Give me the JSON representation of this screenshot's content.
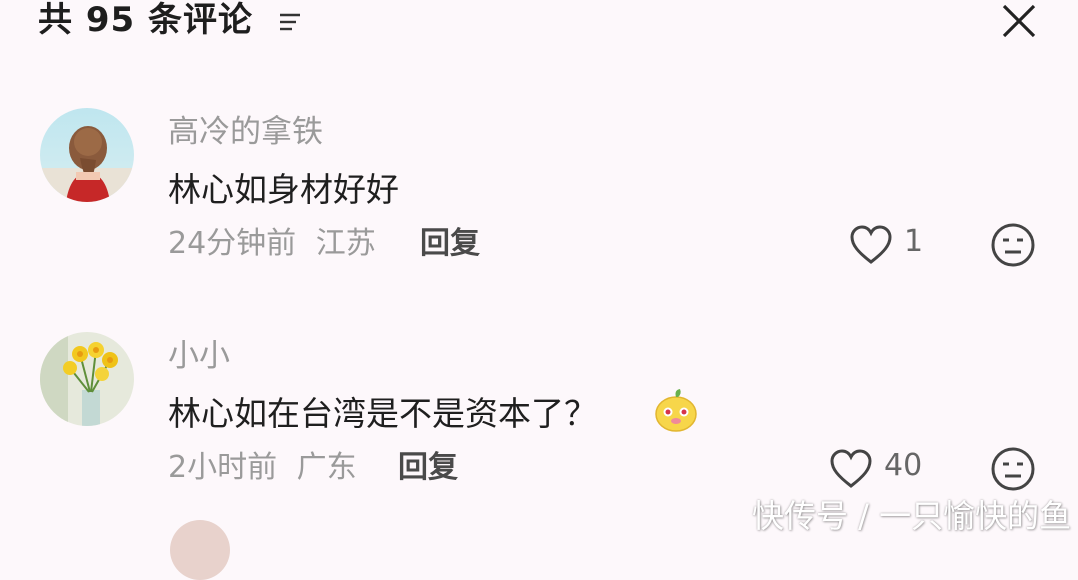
{
  "header": {
    "title": "共 95 条评论",
    "sort_icon": "sort-lines-icon",
    "close_icon": "close-icon"
  },
  "comments": [
    {
      "username": "高冷的拿铁",
      "content": "林心如身材好好",
      "time": "24分钟前",
      "location": "江苏",
      "reply_label": "回复",
      "like_count": "1",
      "avatar_icon": "avatar-woman-red-dress",
      "emoji_icon": "neutral-face-icon"
    },
    {
      "username": "小小",
      "content": "林心如在台湾是不是资本了？",
      "sticker_icon": "yellow-blob-emoji-sticker",
      "time": "2小时前",
      "location": "广东",
      "reply_label": "回复",
      "like_count": "40",
      "avatar_icon": "avatar-yellow-flowers",
      "emoji_icon": "neutral-face-icon"
    }
  ],
  "watermark": "快传号 / 一只愉快的鱼",
  "colors": {
    "background": "#fdf8fb",
    "primary_text": "#1f1f1f",
    "secondary_text": "#9a9a9a"
  }
}
